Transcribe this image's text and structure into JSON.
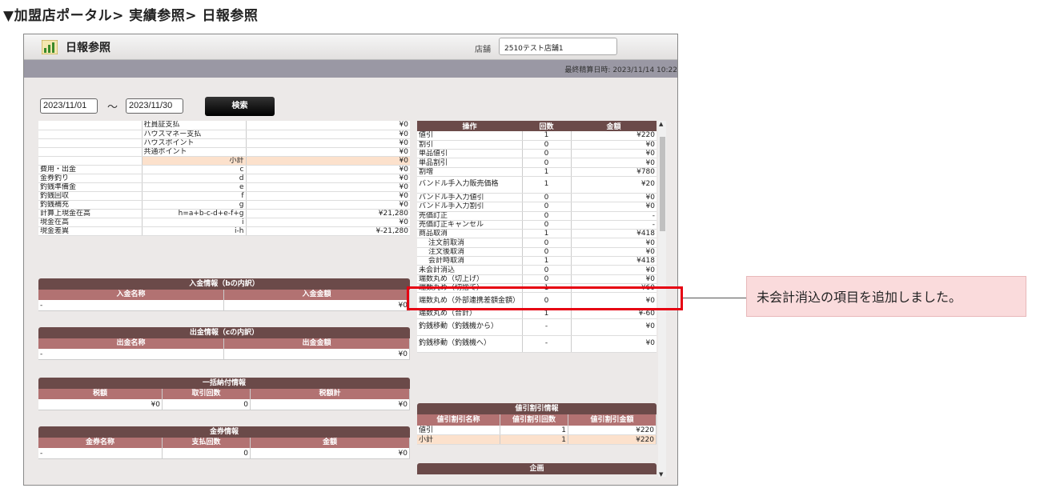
{
  "caption": "▼加盟店ポータル> 実績参照> 日報参照",
  "header": {
    "title": "日報参照",
    "store_label": "店舗",
    "store_value": "2510テスト店舗1",
    "last_calc": "最終精算日時: 2023/11/14 10:22"
  },
  "search": {
    "date_from": "2023/11/01",
    "tilde": "～",
    "date_to": "2023/11/30",
    "button": "検索"
  },
  "left_rows": [
    {
      "a": "",
      "b": "社員証支払",
      "c": "",
      "v": "¥0"
    },
    {
      "a": "",
      "b": "ハウスマネー支払",
      "c": "",
      "v": "¥0"
    },
    {
      "a": "",
      "b": "ハウスポイント",
      "c": "",
      "v": "¥0"
    },
    {
      "a": "",
      "b": "共通ポイント",
      "c": "",
      "v": "¥0"
    },
    {
      "a": "",
      "b": "",
      "c": "小計",
      "v": "¥0",
      "sub": true
    },
    {
      "a": "費用・出金",
      "b": "",
      "c": "c",
      "v": "¥0"
    },
    {
      "a": "金券釣り",
      "b": "",
      "c": "d",
      "v": "¥0"
    },
    {
      "a": "釣銭準備金",
      "b": "",
      "c": "e",
      "v": "¥0"
    },
    {
      "a": "釣銭回収",
      "b": "",
      "c": "f",
      "v": "¥0"
    },
    {
      "a": "釣銭補充",
      "b": "",
      "c": "g",
      "v": "¥0"
    },
    {
      "a": "計算上現金在高",
      "b": "",
      "c": "h=a+b-c-d+e-f+g",
      "v": "¥21,280"
    },
    {
      "a": "現金在高",
      "b": "",
      "c": "i",
      "v": "¥0"
    },
    {
      "a": "現金差異",
      "b": "",
      "c": "i-h",
      "v": "¥-21,280"
    }
  ],
  "deposit": {
    "title": "入金情報（bの内訳）",
    "cols": [
      "入金名称",
      "入金金額"
    ],
    "row": [
      "-",
      "¥0"
    ]
  },
  "withdraw": {
    "title": "出金情報（cの内訳）",
    "cols": [
      "出金名称",
      "出金金額"
    ],
    "row": [
      "-",
      "¥0"
    ]
  },
  "bulk": {
    "title": "一括納付情報",
    "cols": [
      "税額",
      "取引回数",
      "税額計"
    ],
    "row": [
      "¥0",
      "0",
      "¥0"
    ]
  },
  "voucher": {
    "title": "金券情報",
    "cols": [
      "金券名称",
      "支払回数",
      "金額"
    ],
    "row": [
      "-",
      "0",
      "¥0"
    ]
  },
  "right_header": [
    "操作",
    "回数",
    "金額"
  ],
  "right_rows": [
    {
      "n": "値引",
      "c": "1",
      "a": "¥220"
    },
    {
      "n": "割引",
      "c": "0",
      "a": "¥0"
    },
    {
      "n": "単品値引",
      "c": "0",
      "a": "¥0"
    },
    {
      "n": "単品割引",
      "c": "0",
      "a": "¥0"
    },
    {
      "n": "割増",
      "c": "1",
      "a": "¥780"
    },
    {
      "n": "バンドル手入力販売価格",
      "c": "1",
      "a": "¥20",
      "tall": true
    },
    {
      "n": "バンドル手入力値引",
      "c": "0",
      "a": "¥0"
    },
    {
      "n": "バンドル手入力割引",
      "c": "0",
      "a": "¥0"
    },
    {
      "n": "売価訂正",
      "c": "0",
      "a": "-"
    },
    {
      "n": "売価訂正キャンセル",
      "c": "0",
      "a": "-"
    },
    {
      "n": "商品取消",
      "c": "1",
      "a": "¥418"
    },
    {
      "n": "注文前取消",
      "c": "0",
      "a": "¥0",
      "indent": true
    },
    {
      "n": "注文後取消",
      "c": "0",
      "a": "¥0",
      "indent": true
    },
    {
      "n": "会計時取消",
      "c": "1",
      "a": "¥418",
      "indent": true
    },
    {
      "n": "未会計消込",
      "c": "0",
      "a": "¥0"
    },
    {
      "n": "端数丸め（切上げ）",
      "c": "0",
      "a": "¥0"
    },
    {
      "n": "端数丸め（切捨て）",
      "c": "1",
      "a": "¥60"
    },
    {
      "n": "端数丸め（外部連携差額金額）",
      "c": "0",
      "a": "¥0",
      "tall": true
    },
    {
      "n": "端数丸め（合計）",
      "c": "1",
      "a": "¥-60"
    },
    {
      "n": "釣銭移動（釣銭機から）",
      "c": "-",
      "a": "¥0",
      "tall": true
    },
    {
      "n": "釣銭移動（釣銭機へ）",
      "c": "-",
      "a": "¥0",
      "tall": true
    }
  ],
  "discount": {
    "title": "値引割引情報",
    "cols": [
      "値引割引名称",
      "値引割引回数",
      "値引割引金額"
    ],
    "rows": [
      [
        "値引",
        "1",
        "¥220"
      ],
      [
        "小計",
        "1",
        "¥220"
      ]
    ]
  },
  "plan": {
    "title": "企画"
  },
  "callout": "未会計消込の項目を追加しました。"
}
